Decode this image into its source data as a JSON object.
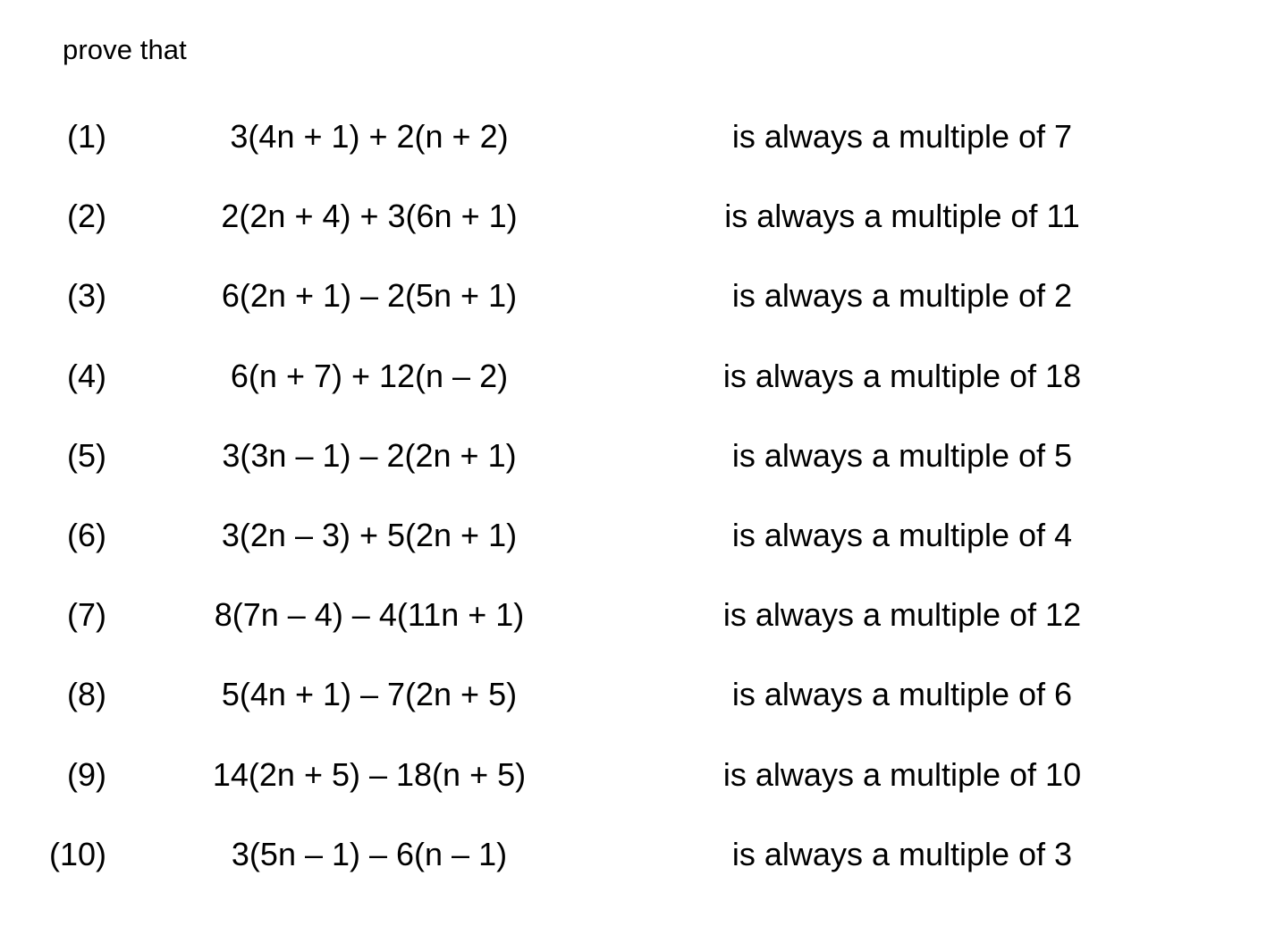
{
  "page": {
    "background_color": "#ffffff",
    "text_color": "#000000",
    "heading": "prove that"
  },
  "questions": [
    {
      "number": "(1)",
      "expression": "3(4n + 1) + 2(n + 2)",
      "statement": "is always a multiple of 7",
      "multiple_of": "7"
    },
    {
      "number": "(2)",
      "expression": "2(2n + 4) + 3(6n + 1)",
      "statement": "is always a multiple of 11",
      "multiple_of": "11"
    },
    {
      "number": "(3)",
      "expression": "6(2n + 1) – 2(5n + 1)",
      "statement": "is always a multiple of 2",
      "multiple_of": "2"
    },
    {
      "number": "(4)",
      "expression": "6(n + 7) + 12(n – 2)",
      "statement": "is always a multiple of 18",
      "multiple_of": "18"
    },
    {
      "number": "(5)",
      "expression": "3(3n – 1) – 2(2n + 1)",
      "statement": "is always a multiple of 5",
      "multiple_of": "5"
    },
    {
      "number": "(6)",
      "expression": "3(2n – 3) + 5(2n + 1)",
      "statement": "is always a multiple of 4",
      "multiple_of": "4"
    },
    {
      "number": "(7)",
      "expression": "8(7n – 4) – 4(11n + 1)",
      "statement": "is always a multiple of 12",
      "multiple_of": "12"
    },
    {
      "number": "(8)",
      "expression": "5(4n + 1) – 7(2n + 5)",
      "statement": "is always a multiple of 6",
      "multiple_of": "6"
    },
    {
      "number": "(9)",
      "expression": "14(2n + 5) – 18(n + 5)",
      "statement": "is always a multiple of 10",
      "multiple_of": "10"
    },
    {
      "number": "(10)",
      "expression": "3(5n – 1) – 6(n – 1)",
      "statement": "is always a multiple of 3",
      "multiple_of": "3"
    }
  ]
}
